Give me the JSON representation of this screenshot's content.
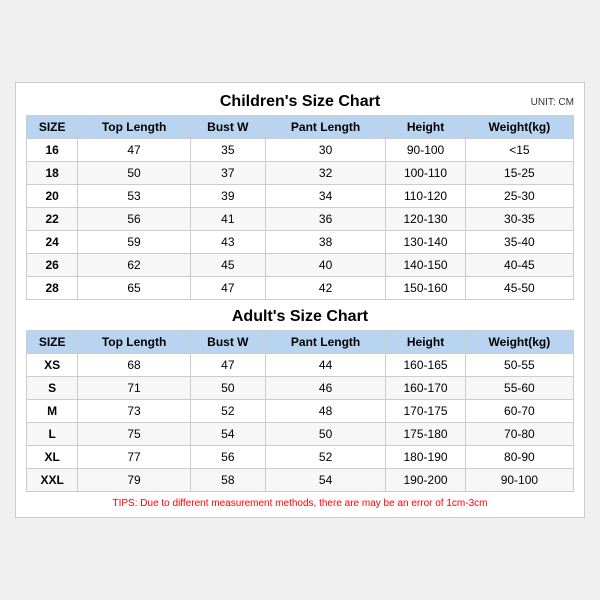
{
  "children": {
    "title": "Children's Size Chart",
    "unit": "UNIT: CM",
    "headers": [
      "SIZE",
      "Top Length",
      "Bust W",
      "Pant Length",
      "Height",
      "Weight(kg)"
    ],
    "rows": [
      [
        "16",
        "47",
        "35",
        "30",
        "90-100",
        "<15"
      ],
      [
        "18",
        "50",
        "37",
        "32",
        "100-110",
        "15-25"
      ],
      [
        "20",
        "53",
        "39",
        "34",
        "110-120",
        "25-30"
      ],
      [
        "22",
        "56",
        "41",
        "36",
        "120-130",
        "30-35"
      ],
      [
        "24",
        "59",
        "43",
        "38",
        "130-140",
        "35-40"
      ],
      [
        "26",
        "62",
        "45",
        "40",
        "140-150",
        "40-45"
      ],
      [
        "28",
        "65",
        "47",
        "42",
        "150-160",
        "45-50"
      ]
    ]
  },
  "adult": {
    "title": "Adult's Size Chart",
    "headers": [
      "SIZE",
      "Top Length",
      "Bust W",
      "Pant Length",
      "Height",
      "Weight(kg)"
    ],
    "rows": [
      [
        "XS",
        "68",
        "47",
        "44",
        "160-165",
        "50-55"
      ],
      [
        "S",
        "71",
        "50",
        "46",
        "160-170",
        "55-60"
      ],
      [
        "M",
        "73",
        "52",
        "48",
        "170-175",
        "60-70"
      ],
      [
        "L",
        "75",
        "54",
        "50",
        "175-180",
        "70-80"
      ],
      [
        "XL",
        "77",
        "56",
        "52",
        "180-190",
        "80-90"
      ],
      [
        "XXL",
        "79",
        "58",
        "54",
        "190-200",
        "90-100"
      ]
    ]
  },
  "tips": "TIPS: Due to different measurement methods, there are may be an error of 1cm-3cm"
}
